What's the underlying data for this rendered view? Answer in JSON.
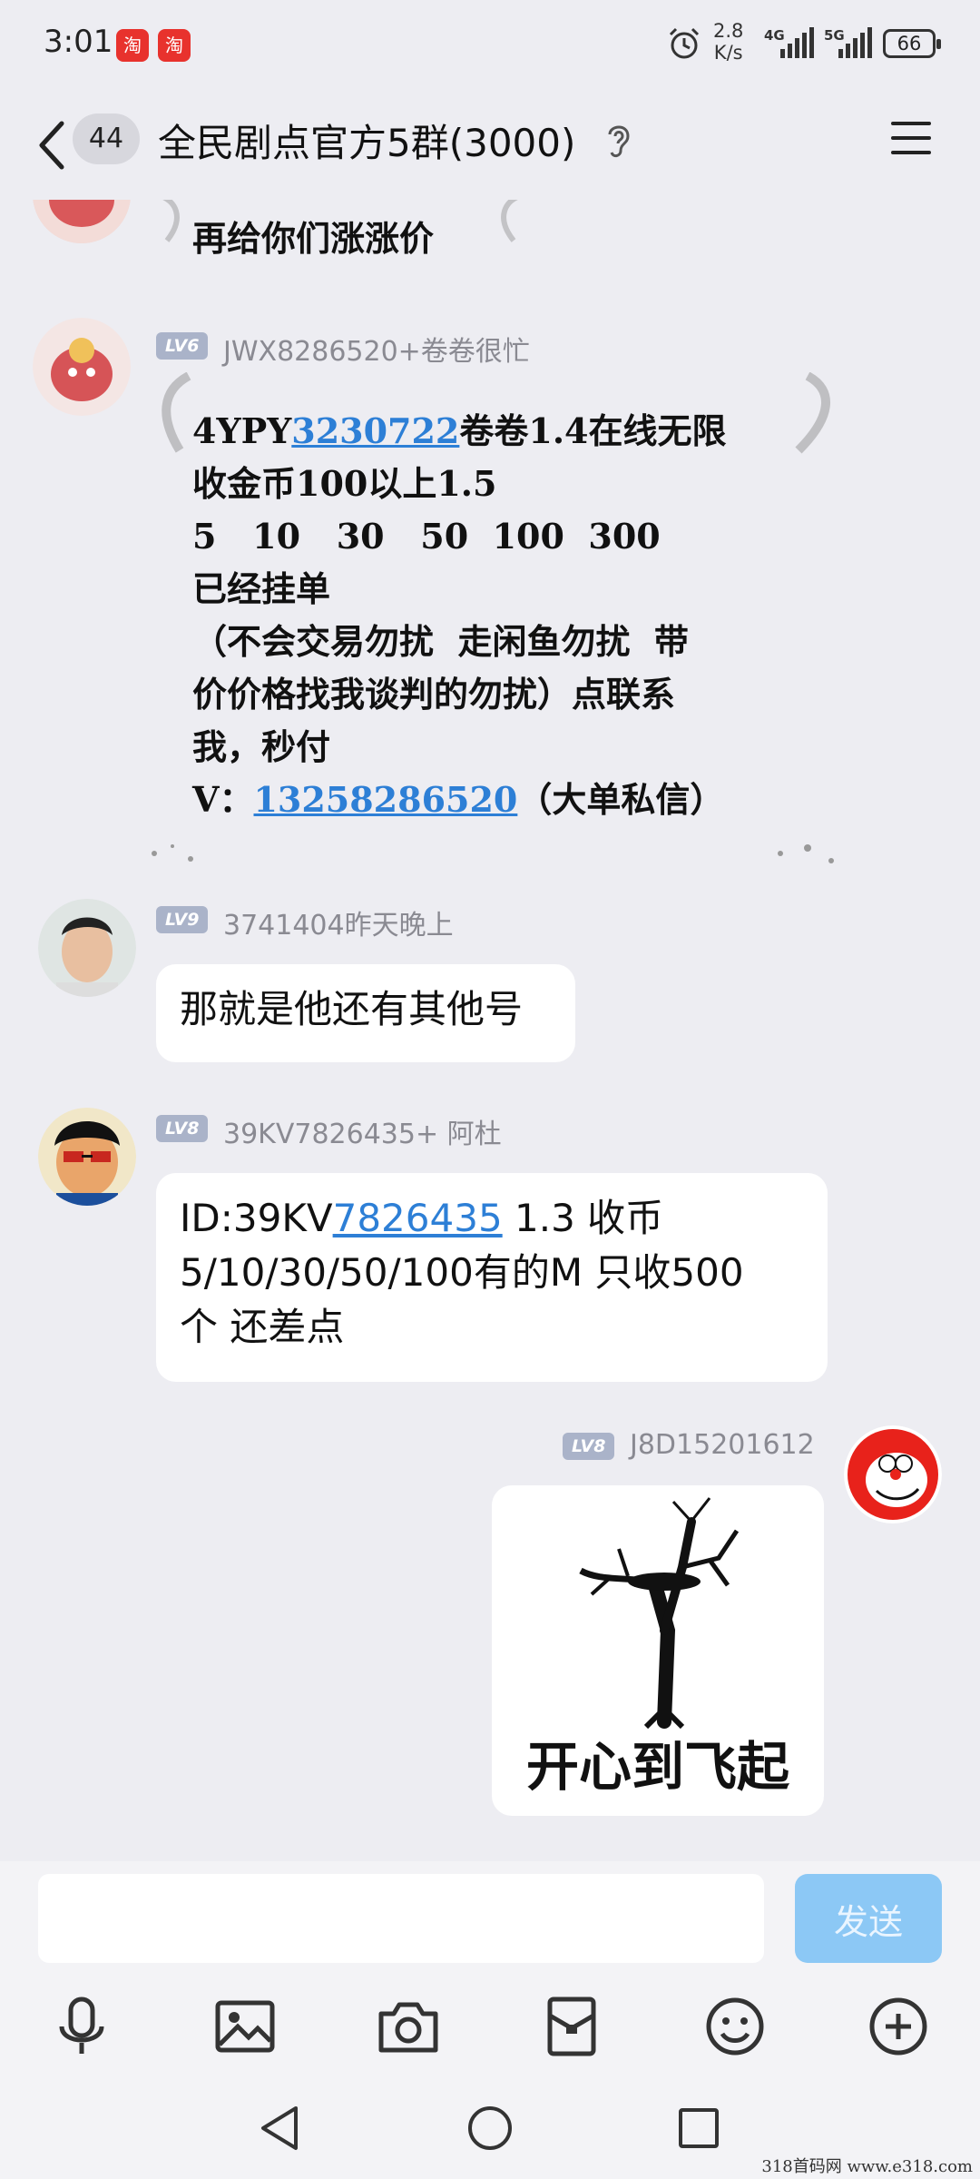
{
  "status_bar": {
    "time": "3:01",
    "app_badge_1": "淘",
    "app_badge_2": "淘",
    "net_speed_value": "2.8",
    "net_speed_unit": "K/s",
    "net_1": "4G",
    "net_2": "5G",
    "battery": "66"
  },
  "header": {
    "unread_count": "44",
    "title": "全民剧点官方5群(3000)"
  },
  "messages": [
    {
      "lines": [
        "再给你们涨涨价"
      ]
    },
    {
      "level": "LV6",
      "sender": "JWX8286520+卷卷很忙",
      "lines_1_prefix": "4YPY",
      "lines_1_link": "3230722",
      "lines_1_suffix": "卷卷1.4在线无限",
      "line_2": "收金币100以上1.5",
      "line_3": "5   10   30   50  100  300",
      "line_4": "已经挂单",
      "line_5": "（不会交易勿扰  走闲鱼勿扰  带",
      "line_6": "价价格找我谈判的勿扰）点联系",
      "line_7": "我，秒付",
      "line_8_prefix": "V：",
      "line_8_link": "13258286520",
      "line_8_suffix": "（大单私信）"
    },
    {
      "level": "LV9",
      "sender": "3741404昨天晚上",
      "text": "那就是他还有其他号"
    },
    {
      "level": "LV8",
      "sender": "39KV7826435+ 阿杜",
      "line_1_prefix": " ID:39KV",
      "line_1_link": "7826435",
      "line_1_suffix": "    1.3 收币",
      "line_2": "5/10/30/50/100有的M  只收500",
      "line_3": "个  还差点"
    },
    {
      "level": "LV8",
      "sender": "J8D15201612",
      "sticker_caption": "开心到飞起"
    }
  ],
  "input": {
    "placeholder": "",
    "send_label": "发送"
  },
  "watermark": "318首码网   www.e318.com"
}
